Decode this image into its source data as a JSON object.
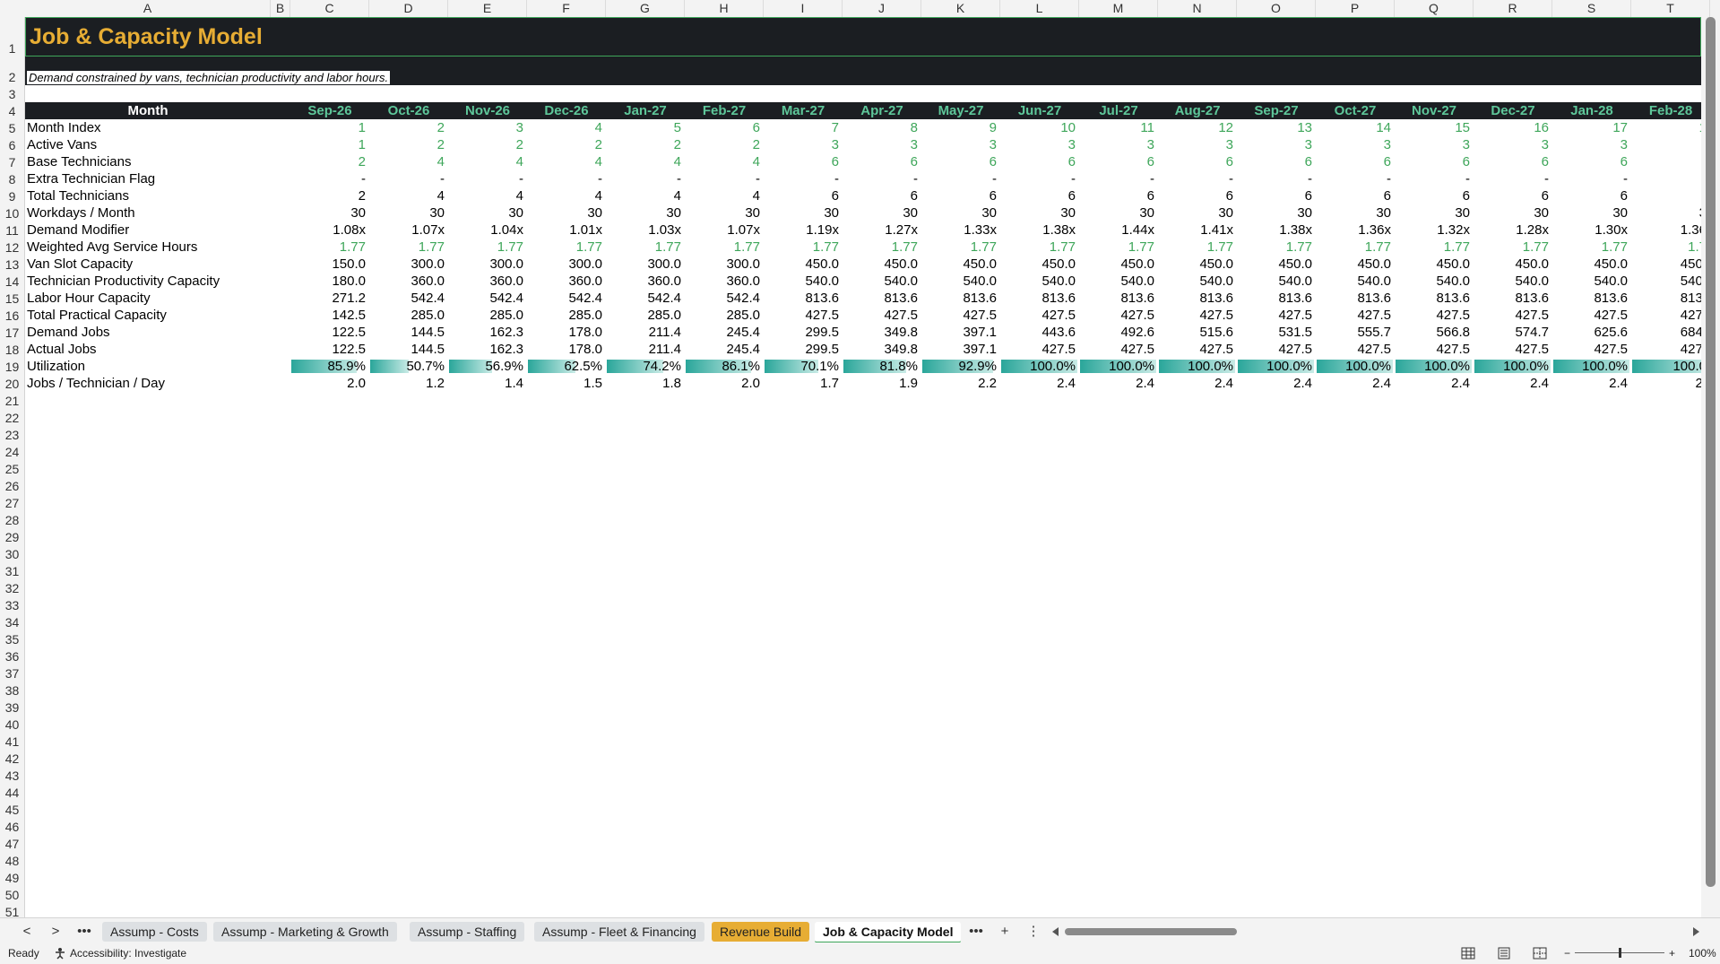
{
  "columns": [
    "A",
    "B",
    "C",
    "D",
    "E",
    "F",
    "G",
    "H",
    "I",
    "J",
    "K",
    "L",
    "M",
    "N",
    "O",
    "P",
    "Q",
    "R",
    "S",
    "T"
  ],
  "rows": [
    "1",
    "2",
    "3",
    "4",
    "5",
    "6",
    "7",
    "8",
    "9",
    "10",
    "11",
    "12",
    "13",
    "14",
    "15",
    "16",
    "17",
    "18",
    "19",
    "20",
    "21",
    "22",
    "23",
    "24",
    "25",
    "26",
    "27",
    "28",
    "29",
    "30",
    "31",
    "32",
    "33",
    "34",
    "35",
    "36",
    "37",
    "38",
    "39",
    "40",
    "41",
    "42",
    "43",
    "44",
    "45",
    "46",
    "47",
    "48",
    "49",
    "50",
    "51"
  ],
  "sheet": {
    "title": "Job & Capacity Model",
    "subtitle": "Demand constrained by vans, technician productivity and labor hours.",
    "header_label": "Month",
    "months": [
      "Sep-26",
      "Oct-26",
      "Nov-26",
      "Dec-26",
      "Jan-27",
      "Feb-27",
      "Mar-27",
      "Apr-27",
      "May-27",
      "Jun-27",
      "Jul-27",
      "Aug-27",
      "Sep-27",
      "Oct-27",
      "Nov-27",
      "Dec-27",
      "Jan-28",
      "Feb-28"
    ],
    "table": [
      {
        "label": "Month Index",
        "green": true,
        "values": [
          "1",
          "2",
          "3",
          "4",
          "5",
          "6",
          "7",
          "8",
          "9",
          "10",
          "11",
          "12",
          "13",
          "14",
          "15",
          "16",
          "17",
          "1"
        ]
      },
      {
        "label": "Active Vans",
        "green": true,
        "values": [
          "1",
          "2",
          "2",
          "2",
          "2",
          "2",
          "3",
          "3",
          "3",
          "3",
          "3",
          "3",
          "3",
          "3",
          "3",
          "3",
          "3",
          ""
        ]
      },
      {
        "label": "Base Technicians",
        "green": true,
        "values": [
          "2",
          "4",
          "4",
          "4",
          "4",
          "4",
          "6",
          "6",
          "6",
          "6",
          "6",
          "6",
          "6",
          "6",
          "6",
          "6",
          "6",
          ""
        ]
      },
      {
        "label": "Extra Technician Flag",
        "green": false,
        "values": [
          "-",
          "-",
          "-",
          "-",
          "-",
          "-",
          "-",
          "-",
          "-",
          "-",
          "-",
          "-",
          "-",
          "-",
          "-",
          "-",
          "-",
          ""
        ]
      },
      {
        "label": "Total Technicians",
        "green": false,
        "values": [
          "2",
          "4",
          "4",
          "4",
          "4",
          "4",
          "6",
          "6",
          "6",
          "6",
          "6",
          "6",
          "6",
          "6",
          "6",
          "6",
          "6",
          ""
        ]
      },
      {
        "label": "Workdays / Month",
        "green": false,
        "values": [
          "30",
          "30",
          "30",
          "30",
          "30",
          "30",
          "30",
          "30",
          "30",
          "30",
          "30",
          "30",
          "30",
          "30",
          "30",
          "30",
          "30",
          "3"
        ]
      },
      {
        "label": "Demand Modifier",
        "green": false,
        "values": [
          "1.08x",
          "1.07x",
          "1.04x",
          "1.01x",
          "1.03x",
          "1.07x",
          "1.19x",
          "1.27x",
          "1.33x",
          "1.38x",
          "1.44x",
          "1.41x",
          "1.38x",
          "1.36x",
          "1.32x",
          "1.28x",
          "1.30x",
          "1.36"
        ]
      },
      {
        "label": "Weighted Avg Service Hours",
        "green": true,
        "values": [
          "1.77",
          "1.77",
          "1.77",
          "1.77",
          "1.77",
          "1.77",
          "1.77",
          "1.77",
          "1.77",
          "1.77",
          "1.77",
          "1.77",
          "1.77",
          "1.77",
          "1.77",
          "1.77",
          "1.77",
          "1.7"
        ]
      },
      {
        "label": "Van Slot Capacity",
        "green": false,
        "values": [
          "150.0",
          "300.0",
          "300.0",
          "300.0",
          "300.0",
          "300.0",
          "450.0",
          "450.0",
          "450.0",
          "450.0",
          "450.0",
          "450.0",
          "450.0",
          "450.0",
          "450.0",
          "450.0",
          "450.0",
          "450."
        ]
      },
      {
        "label": "Technician Productivity Capacity",
        "green": false,
        "values": [
          "180.0",
          "360.0",
          "360.0",
          "360.0",
          "360.0",
          "360.0",
          "540.0",
          "540.0",
          "540.0",
          "540.0",
          "540.0",
          "540.0",
          "540.0",
          "540.0",
          "540.0",
          "540.0",
          "540.0",
          "540."
        ]
      },
      {
        "label": "Labor Hour Capacity",
        "green": false,
        "values": [
          "271.2",
          "542.4",
          "542.4",
          "542.4",
          "542.4",
          "542.4",
          "813.6",
          "813.6",
          "813.6",
          "813.6",
          "813.6",
          "813.6",
          "813.6",
          "813.6",
          "813.6",
          "813.6",
          "813.6",
          "813."
        ]
      },
      {
        "label": "Total Practical Capacity",
        "green": false,
        "values": [
          "142.5",
          "285.0",
          "285.0",
          "285.0",
          "285.0",
          "285.0",
          "427.5",
          "427.5",
          "427.5",
          "427.5",
          "427.5",
          "427.5",
          "427.5",
          "427.5",
          "427.5",
          "427.5",
          "427.5",
          "427."
        ]
      },
      {
        "label": "Demand Jobs",
        "green": false,
        "values": [
          "122.5",
          "144.5",
          "162.3",
          "178.0",
          "211.4",
          "245.4",
          "299.5",
          "349.8",
          "397.1",
          "443.6",
          "492.6",
          "515.6",
          "531.5",
          "555.7",
          "566.8",
          "574.7",
          "625.6",
          "684."
        ]
      },
      {
        "label": "Actual Jobs",
        "green": false,
        "values": [
          "122.5",
          "144.5",
          "162.3",
          "178.0",
          "211.4",
          "245.4",
          "299.5",
          "349.8",
          "397.1",
          "427.5",
          "427.5",
          "427.5",
          "427.5",
          "427.5",
          "427.5",
          "427.5",
          "427.5",
          "427."
        ]
      },
      {
        "label": "Utilization",
        "green": false,
        "databar": true,
        "values": [
          "85.9%",
          "50.7%",
          "56.9%",
          "62.5%",
          "74.2%",
          "86.1%",
          "70.1%",
          "81.8%",
          "92.9%",
          "100.0%",
          "100.0%",
          "100.0%",
          "100.0%",
          "100.0%",
          "100.0%",
          "100.0%",
          "100.0%",
          "100.0"
        ],
        "fill": [
          0.859,
          0.507,
          0.569,
          0.625,
          0.742,
          0.861,
          0.701,
          0.818,
          0.929,
          1,
          1,
          1,
          1,
          1,
          1,
          1,
          1,
          1
        ]
      },
      {
        "label": "Jobs / Technician / Day",
        "green": false,
        "values": [
          "2.0",
          "1.2",
          "1.4",
          "1.5",
          "1.8",
          "2.0",
          "1.7",
          "1.9",
          "2.2",
          "2.4",
          "2.4",
          "2.4",
          "2.4",
          "2.4",
          "2.4",
          "2.4",
          "2.4",
          "2."
        ]
      }
    ]
  },
  "tabs": {
    "costs": "Assump - Costs",
    "marketing": "Assump - Marketing & Growth",
    "staffing": "Assump - Staffing",
    "fleet": "Assump - Fleet & Financing",
    "revenue": "Revenue Build",
    "capacity": "Job & Capacity Model",
    "more": "•••",
    "add": "+",
    "menu": "⋮",
    "prev": "<",
    "next": ">"
  },
  "status": {
    "ready": "Ready",
    "accessibility": "Accessibility: Investigate",
    "zoom": "100%"
  },
  "colors": {
    "title_bg": "#1b1e22",
    "title_text": "#e7ad34",
    "header_green": "#5ec79a",
    "value_green": "#3ea65a",
    "databar": "#2aa69a"
  }
}
